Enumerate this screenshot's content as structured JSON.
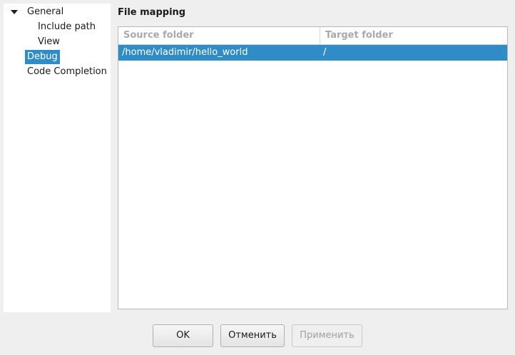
{
  "sidebar": {
    "items": [
      {
        "label": "General",
        "expanded": true
      },
      {
        "label": "Include path"
      },
      {
        "label": "View"
      },
      {
        "label": "Debug",
        "selected": true
      },
      {
        "label": "Code Completion"
      }
    ]
  },
  "main": {
    "section_title": "File mapping",
    "table": {
      "columns": [
        "Source folder",
        "Target folder"
      ],
      "rows": [
        {
          "source": "/home/vladimir/hello_world",
          "target": "/",
          "selected": true
        }
      ]
    }
  },
  "buttons": {
    "ok": "OK",
    "cancel": "Отменить",
    "apply": "Применить",
    "apply_enabled": false
  },
  "colors": {
    "selection": "#308cc6",
    "window_bg": "#efefef",
    "header_text": "#a9a9a9"
  }
}
